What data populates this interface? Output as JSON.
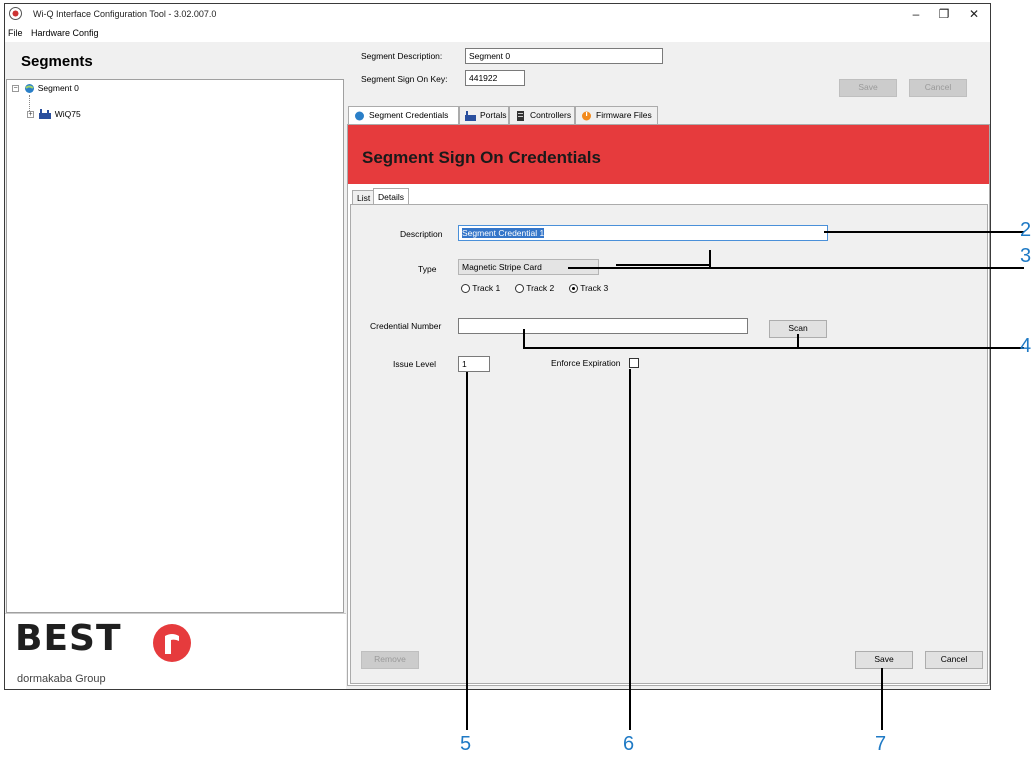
{
  "window": {
    "title": "Wi-Q Interface Configuration Tool - 3.02.007.0",
    "controls": {
      "minimize": "–",
      "restore": "❐",
      "close": "✕"
    }
  },
  "menu": [
    "File",
    "Hardware Config"
  ],
  "sidebar": {
    "title": "Segments",
    "tree": [
      {
        "label": "Segment 0",
        "expander": "−"
      },
      {
        "label": "WiQ75",
        "expander": "+"
      }
    ],
    "logo": {
      "brand": "BEST",
      "group": "dormakaba Group"
    }
  },
  "segment": {
    "description_label": "Segment Description:",
    "description_value": "Segment 0",
    "signon_label": "Segment Sign On Key:",
    "signon_value": "441922",
    "save_label": "Save",
    "cancel_label": "Cancel"
  },
  "tabs": [
    {
      "label": "Segment Credentials",
      "active": true
    },
    {
      "label": "Portals",
      "active": false
    },
    {
      "label": "Controllers",
      "active": false
    },
    {
      "label": "Firmware Files",
      "active": false
    }
  ],
  "banner": {
    "title": "Segment Sign On Credentials"
  },
  "subtabs": [
    {
      "label": "List",
      "active": false
    },
    {
      "label": "Details",
      "active": true
    }
  ],
  "form": {
    "description_label": "Description",
    "description_value": "Segment Credential 1",
    "type_label": "Type",
    "type_value": "Magnetic Stripe Card",
    "tracks": [
      {
        "label": "Track 1",
        "selected": false
      },
      {
        "label": "Track 2",
        "selected": false
      },
      {
        "label": "Track 3",
        "selected": true
      }
    ],
    "credential_label": "Credential Number",
    "credential_value": "",
    "scan_label": "Scan",
    "issue_label": "Issue Level",
    "issue_value": "1",
    "enforce_label": "Enforce Expiration",
    "enforce_checked": false,
    "remove_label": "Remove",
    "save_label": "Save",
    "cancel_label": "Cancel"
  },
  "callouts": [
    "2",
    "3",
    "4",
    "5",
    "6",
    "7"
  ],
  "colors": {
    "banner": "#e63b3d",
    "callout": "#1f7ac5",
    "logo_mark": "#e63b3d"
  }
}
